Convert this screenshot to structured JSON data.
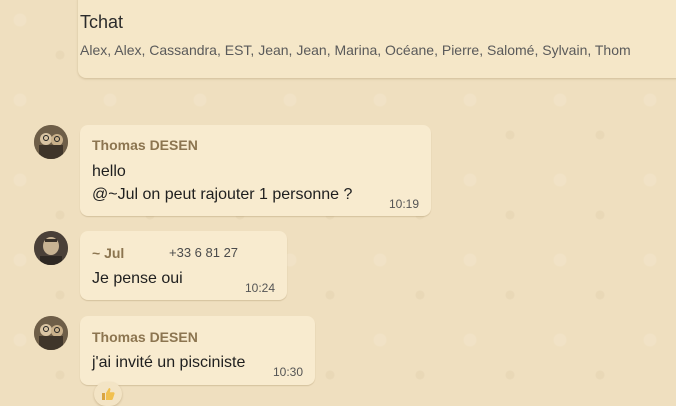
{
  "group": {
    "title": "Tchat",
    "members": "Alex, Alex, Cassandra, EST, Jean, Jean, Marina, Océane, Pierre, Salomé, Sylvain, Thom"
  },
  "messages": [
    {
      "sender": "Thomas DESEN",
      "line1": "hello",
      "line2": "@~Jul on peut rajouter 1 personne ?",
      "time": "10:19"
    },
    {
      "sender": "~ Jul",
      "phone": "+33 6 81 27",
      "line1": "Je pense oui",
      "time": "10:24"
    },
    {
      "sender": "Thomas DESEN",
      "line1": "j'ai invité un pisciniste",
      "time": "10:30",
      "reaction": "thumbs-up-icon"
    }
  ],
  "colors": {
    "background": "#efdfbf",
    "bubble": "#f8ebcf",
    "sender": "#8c7550"
  }
}
